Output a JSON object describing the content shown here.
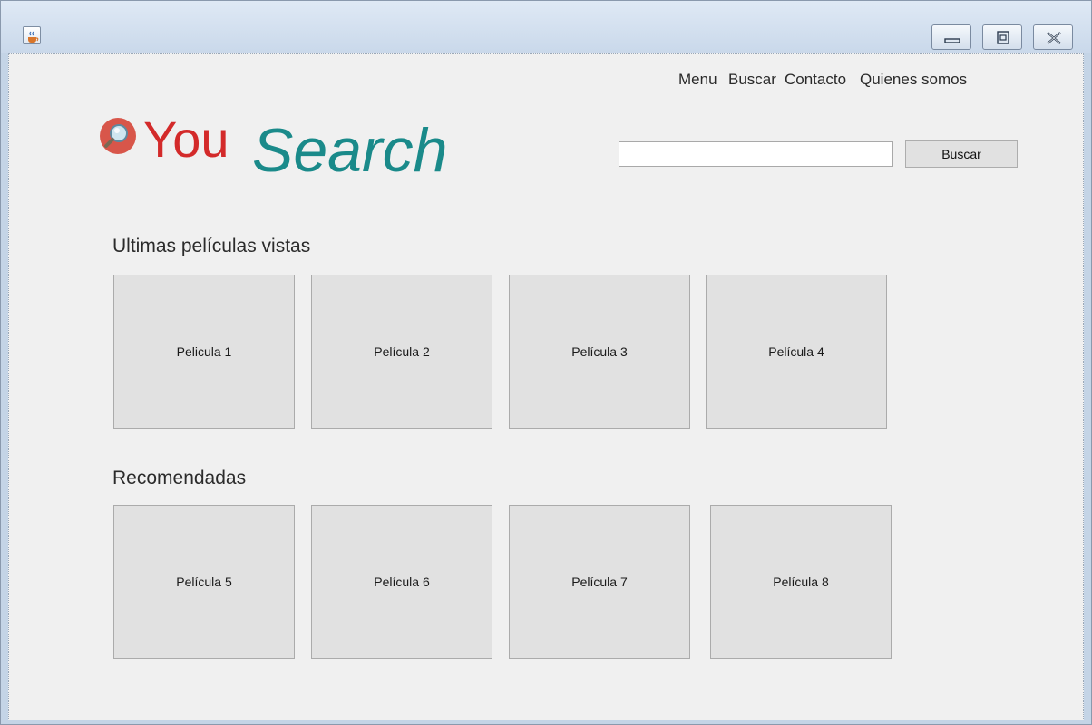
{
  "nav": {
    "items": [
      "Menu",
      "Buscar",
      "Contacto",
      "Quienes somos"
    ]
  },
  "logo": {
    "part1": "You",
    "part2": "Search"
  },
  "search": {
    "value": "",
    "button_label": "Buscar"
  },
  "sections": {
    "recent": {
      "title": "Ultimas películas vistas",
      "items": [
        "Pelicula 1",
        "Película 2",
        "Película 3",
        "Película 4"
      ]
    },
    "recommended": {
      "title": "Recomendadas",
      "items": [
        "Película 5",
        "Película 6",
        "Película 7",
        "Película 8"
      ]
    }
  },
  "colors": {
    "logo_you": "#d32a2a",
    "logo_search": "#1a8a8a",
    "window_frame": "#c4d4e6"
  },
  "icons": {
    "app": "java-cup-icon",
    "window_controls": [
      "minimize-icon",
      "maximize-icon",
      "close-icon"
    ],
    "logo": "magnifier-icon"
  }
}
